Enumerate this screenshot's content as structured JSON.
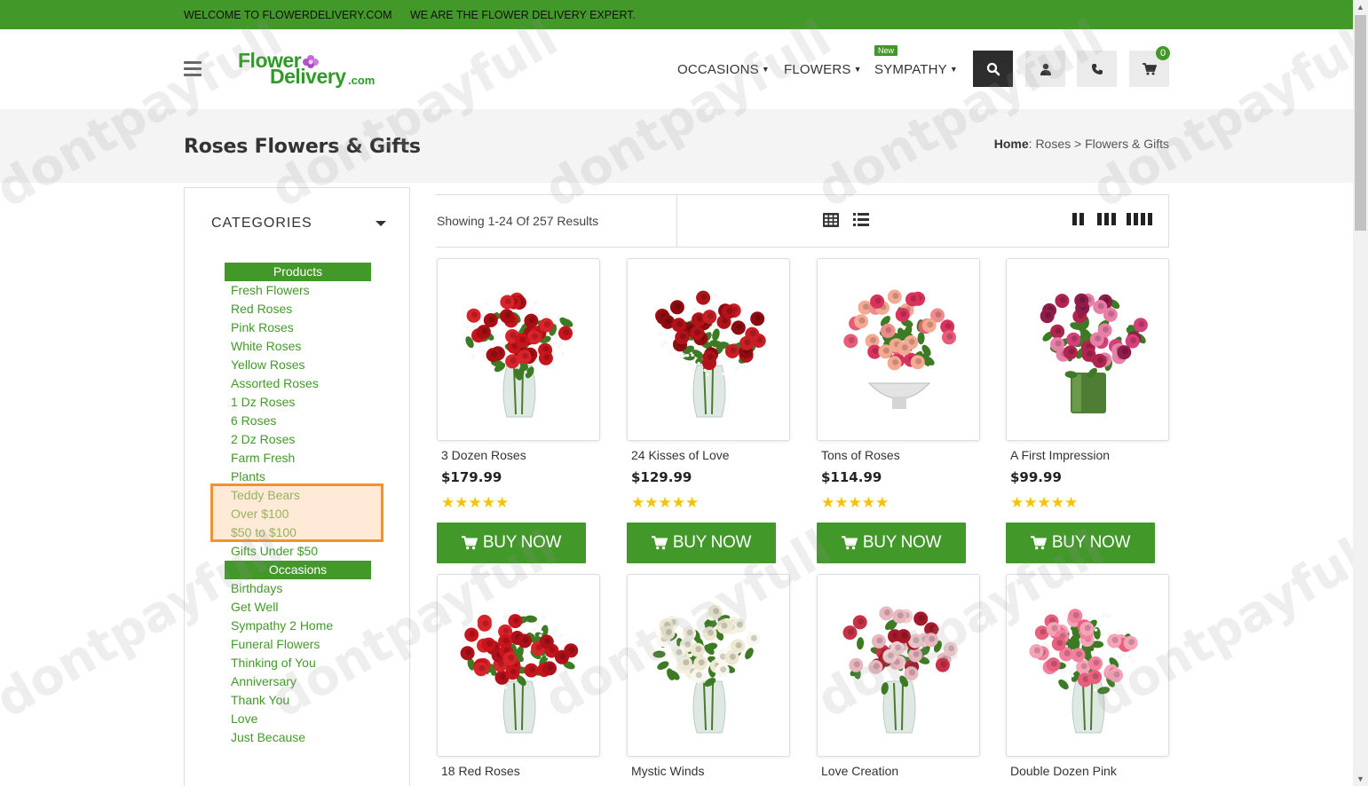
{
  "topbar": {
    "welcome": "WELCOME TO FLOWERDELIVERY.COM",
    "tagline": "WE ARE THE FLOWER DELIVERY EXPERT."
  },
  "logo": {
    "line1": "Flower",
    "line2": "Delivery",
    "suffix": ".com"
  },
  "nav": {
    "occasions": "OCCASIONS",
    "flowers": "FLOWERS",
    "sympathy": "SYMPATHY",
    "new_badge": "New"
  },
  "cart": {
    "count": "0"
  },
  "page": {
    "title": "Roses Flowers & Gifts"
  },
  "breadcrumb": {
    "home": "Home",
    "sep": ":",
    "roses": "Roses",
    "arrow": ">",
    "current": "Flowers & Gifts"
  },
  "sidebar": {
    "heading": "CATEGORIES",
    "products_header": "Products",
    "products": [
      "Fresh Flowers",
      "Red Roses",
      "Pink Roses",
      "White Roses",
      "Yellow Roses",
      "Assorted Roses",
      "1 Dz Roses",
      "6 Roses",
      "2 Dz Roses",
      "Farm Fresh",
      "Plants",
      "Teddy Bears",
      "Over $100",
      "$50 to $100",
      "Gifts Under $50"
    ],
    "occasions_header": "Occasions",
    "occasions": [
      "Birthdays",
      "Get Well",
      "Sympathy 2 Home",
      "Funeral Flowers",
      "Thinking of You",
      "Anniversary",
      "Thank You",
      "Love",
      "Just Because"
    ]
  },
  "toolbar": {
    "showing": "Showing 1-24 Of 257 Results"
  },
  "products": [
    {
      "name": "3 Dozen Roses",
      "price": "$179.99",
      "stars": "★★★★★",
      "buy": "BUY NOW"
    },
    {
      "name": "24 Kisses of Love",
      "price": "$129.99",
      "stars": "★★★★★",
      "buy": "BUY NOW"
    },
    {
      "name": "Tons of Roses",
      "price": "$114.99",
      "stars": "★★★★★",
      "buy": "BUY NOW"
    },
    {
      "name": "A First Impression",
      "price": "$99.99",
      "stars": "★★★★★",
      "buy": "BUY NOW"
    },
    {
      "name": "18 Red Roses"
    },
    {
      "name": "Mystic Winds"
    },
    {
      "name": "Love Creation"
    },
    {
      "name": "Double Dozen Pink"
    }
  ],
  "watermark": "dontpayfull",
  "colors": {
    "brand_green": "#43982a",
    "highlight_border": "#f0922e",
    "star": "#f7c300"
  }
}
